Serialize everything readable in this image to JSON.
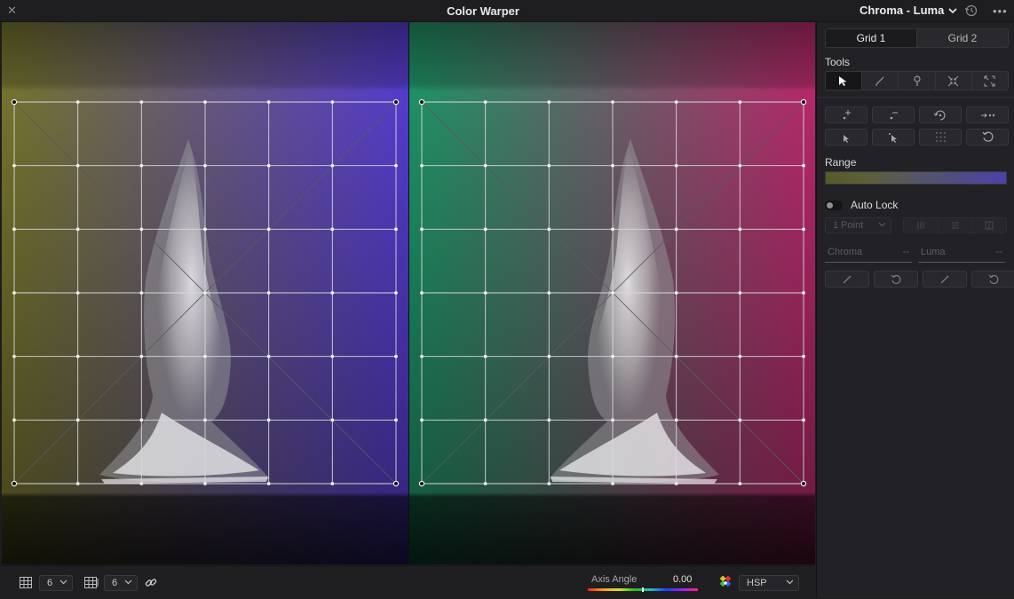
{
  "window": {
    "title": "Color Warper",
    "mode": "Chroma - Luma",
    "close_icon": "close-icon",
    "history_icon": "history-reset-icon",
    "more_icon": "more-options-icon",
    "more_glyph": "•••"
  },
  "viewer": {
    "left_colors": {
      "top_left": "#7a7a2e",
      "top_right": "#5a3ed8",
      "bottom_left": "#48481e",
      "bottom_right": "#2a2270"
    },
    "right_colors": {
      "top_left": "#1f9a6a",
      "top_right": "#c02a70",
      "bottom_left": "#0f5a3a",
      "bottom_right": "#6a1640"
    },
    "grid_columns": 6,
    "grid_rows": 6
  },
  "bottom": {
    "grid_cols_value": "6",
    "grid_rows_value": "6",
    "axis_angle_label": "Axis Angle",
    "axis_angle_value": "0.00",
    "color_space_value": "HSP",
    "icons": [
      "grid-columns-icon",
      "grid-rows-icon",
      "link-icon",
      "color-wheel-icon"
    ]
  },
  "panel": {
    "tabs": [
      "Grid 1",
      "Grid 2"
    ],
    "active_tab": "Grid 1",
    "tools_label": "Tools",
    "tools": [
      "select-arrow-icon",
      "pen-icon",
      "pin-icon",
      "contract-icon",
      "expand-icon"
    ],
    "range_label": "Range",
    "range_colors": [
      "#59592a",
      "#4c42a8"
    ],
    "auto_lock_label": "Auto Lock",
    "point_select_value": "1 Point",
    "chroma_label": "Chroma",
    "chroma_value": "--",
    "luma_label": "Luma",
    "luma_value": "--"
  }
}
